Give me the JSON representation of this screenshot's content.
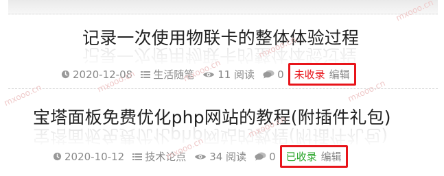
{
  "posts": [
    {
      "title": "记录一次使用物联卡的整体体验过程",
      "date": "2020-12-08",
      "category": "生活随笔",
      "views": "11 阅读",
      "comments": "0",
      "status": "未收录",
      "edit": "编辑",
      "status_color": "#e8141a"
    },
    {
      "title": "宝塔面板免费优化php网站的教程(附插件礼包)",
      "date": "2020-10-12",
      "category": "技术论点",
      "views": "34 阅读",
      "comments": "0",
      "status": "已收录",
      "edit": "编辑",
      "status_color": "#2aa52a"
    }
  ],
  "watermark": "mxooo.cn",
  "icons": [
    "clock-icon",
    "list-icon",
    "eye-icon",
    "comment-icon"
  ],
  "colors": {
    "highlight_box": "#e8141a",
    "meta_text": "#888888"
  }
}
